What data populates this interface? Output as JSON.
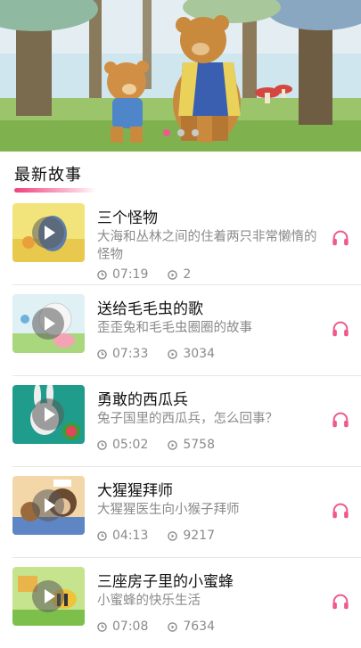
{
  "banner": {
    "slides": 3,
    "active_index": 0
  },
  "section": {
    "title": "最新故事"
  },
  "stories": [
    {
      "title": "三个怪物",
      "desc": "大海和丛林之间的住着两只非常懒惰的怪物",
      "duration": "07:19",
      "plays": "2",
      "desc_lines": 2
    },
    {
      "title": "送给毛毛虫的歌",
      "desc": "歪歪兔和毛毛虫圈圈的故事",
      "duration": "07:33",
      "plays": "3034",
      "desc_lines": 1
    },
    {
      "title": "勇敢的西瓜兵",
      "desc": "兔子国里的西瓜兵，怎么回事？",
      "duration": "05:02",
      "plays": "5758",
      "desc_lines": 1
    },
    {
      "title": "大猩猩拜师",
      "desc": "大猩猩医生向小猴子拜师",
      "duration": "04:13",
      "plays": "9217",
      "desc_lines": 1
    },
    {
      "title": "三座房子里的小蜜蜂",
      "desc": "小蜜蜂的快乐生活",
      "duration": "07:08",
      "plays": "7634",
      "desc_lines": 1
    }
  ],
  "colors": {
    "accent": "#f05a8a",
    "meta_text": "#8a8a8a"
  },
  "icons": {
    "duration": "clock-icon",
    "plays": "play-count-icon",
    "listen": "headphones-icon"
  }
}
